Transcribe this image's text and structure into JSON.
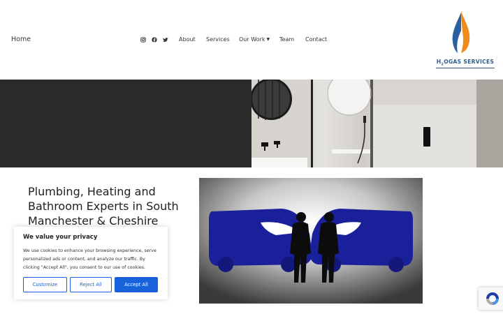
{
  "header": {
    "home_label": "Home",
    "social_icons": [
      "instagram-icon",
      "facebook-icon",
      "twitter-icon"
    ],
    "nav": {
      "about": "About",
      "services": "Services",
      "our_work": "Our Work",
      "team": "Team",
      "contact": "Contact"
    },
    "logo": {
      "text_a": "H",
      "text_sub": "2",
      "text_b": "OGAS SERVICES"
    }
  },
  "main": {
    "headline": "Plumbing, Heating and Bathroom Experts in South Manchester & Cheshire"
  },
  "cookie_banner": {
    "title": "We value your privacy",
    "text": "We use cookies to enhance your browsing experience, serve personalized ads or content, and analyze our traffic. By clicking \"Accept All\", you consent to our use of cookies.",
    "customize": "Customize",
    "reject": "Reject All",
    "accept": "Accept All"
  },
  "colors": {
    "accent_blue": "#1863dc",
    "logo_blue": "#2e5a8a",
    "flame_orange": "#f08a1c",
    "hero_dark": "#2b2b2b",
    "van_blue": "#1a1f9a"
  }
}
